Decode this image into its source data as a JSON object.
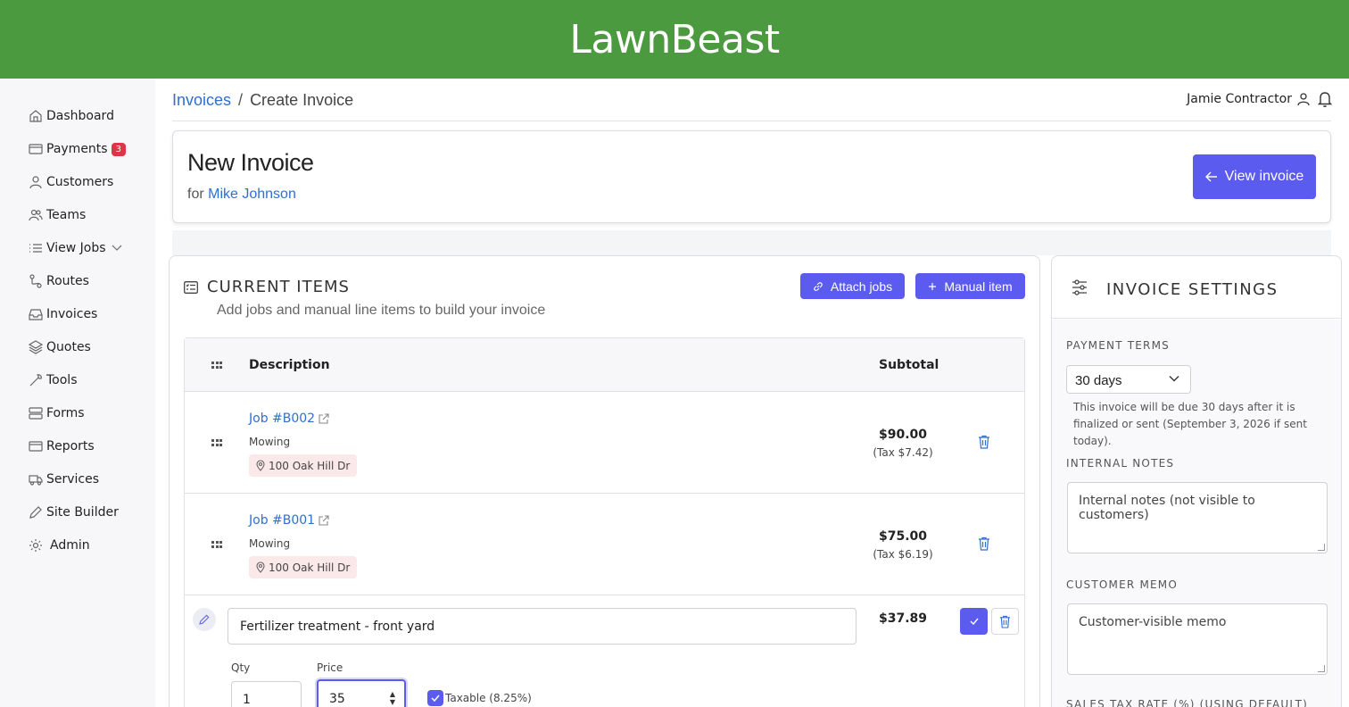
{
  "app": {
    "brand": "LawnBeast"
  },
  "sidebar": {
    "items": [
      {
        "label": "Dashboard",
        "icon": "home-icon"
      },
      {
        "label": "Payments",
        "icon": "credit-card-icon",
        "badge": "3"
      },
      {
        "label": "Customers",
        "icon": "user-icon"
      },
      {
        "label": "Teams",
        "icon": "users-icon"
      },
      {
        "label": "View Jobs",
        "icon": "list-icon"
      },
      {
        "label": "Routes",
        "icon": "route-icon"
      },
      {
        "label": "Invoices",
        "icon": "inbox-icon"
      },
      {
        "label": "Quotes",
        "icon": "layers-icon"
      },
      {
        "label": "Tools",
        "icon": "wrench-icon"
      },
      {
        "label": "Forms",
        "icon": "form-icon"
      },
      {
        "label": "Reports",
        "icon": "report-icon"
      },
      {
        "label": "Services",
        "icon": "truck-icon"
      },
      {
        "label": "Site Builder",
        "icon": "pencil-icon"
      },
      {
        "label": "Admin",
        "icon": "gear-icon"
      }
    ]
  },
  "breadcrumb": {
    "parent": "Invoices",
    "current": "Create Invoice"
  },
  "user": {
    "name": "Jamie Contractor"
  },
  "header": {
    "title": "New Invoice",
    "for_prefix": "for",
    "customer": "Mike Johnson",
    "view_button": "View invoice"
  },
  "items": {
    "title": "CURRENT ITEMS",
    "subtitle": "Add jobs and manual line items to build your invoice",
    "attach_button": "Attach jobs",
    "manual_button": "Manual item",
    "columns": {
      "description": "Description",
      "subtotal": "Subtotal"
    },
    "rows": [
      {
        "job": "Job #B002",
        "type": "Mowing",
        "address": "100 Oak Hill Dr",
        "amount": "$90.00",
        "tax": "(Tax $7.42)"
      },
      {
        "job": "Job #B001",
        "type": "Mowing",
        "address": "100 Oak Hill Dr",
        "amount": "$75.00",
        "tax": "(Tax $6.19)"
      }
    ],
    "manual": {
      "description": "Fertilizer treatment - front yard",
      "amount": "$37.89",
      "qty_label": "Qty",
      "qty": "1",
      "price_label": "Price",
      "price": "35",
      "taxable_label": "Taxable (8.25%)",
      "taxable": true
    }
  },
  "settings": {
    "title": "INVOICE SETTINGS",
    "payment_terms_label": "PAYMENT TERMS",
    "payment_terms": "30 days",
    "payment_help": "This invoice will be due 30 days after it is finalized or sent (September 3, 2026 if sent today).",
    "internal_notes_label": "INTERNAL NOTES",
    "internal_notes_placeholder": "Internal notes (not visible to customers)",
    "customer_memo_label": "CUSTOMER MEMO",
    "customer_memo_placeholder": "Customer-visible memo",
    "sales_tax_label": "SALES TAX RATE (%) (USING DEFAULT)"
  },
  "colors": {
    "brand_green": "#4c9a3f",
    "primary": "#5b5bf0",
    "link": "#2f6fd0",
    "badge": "#dc3545"
  }
}
